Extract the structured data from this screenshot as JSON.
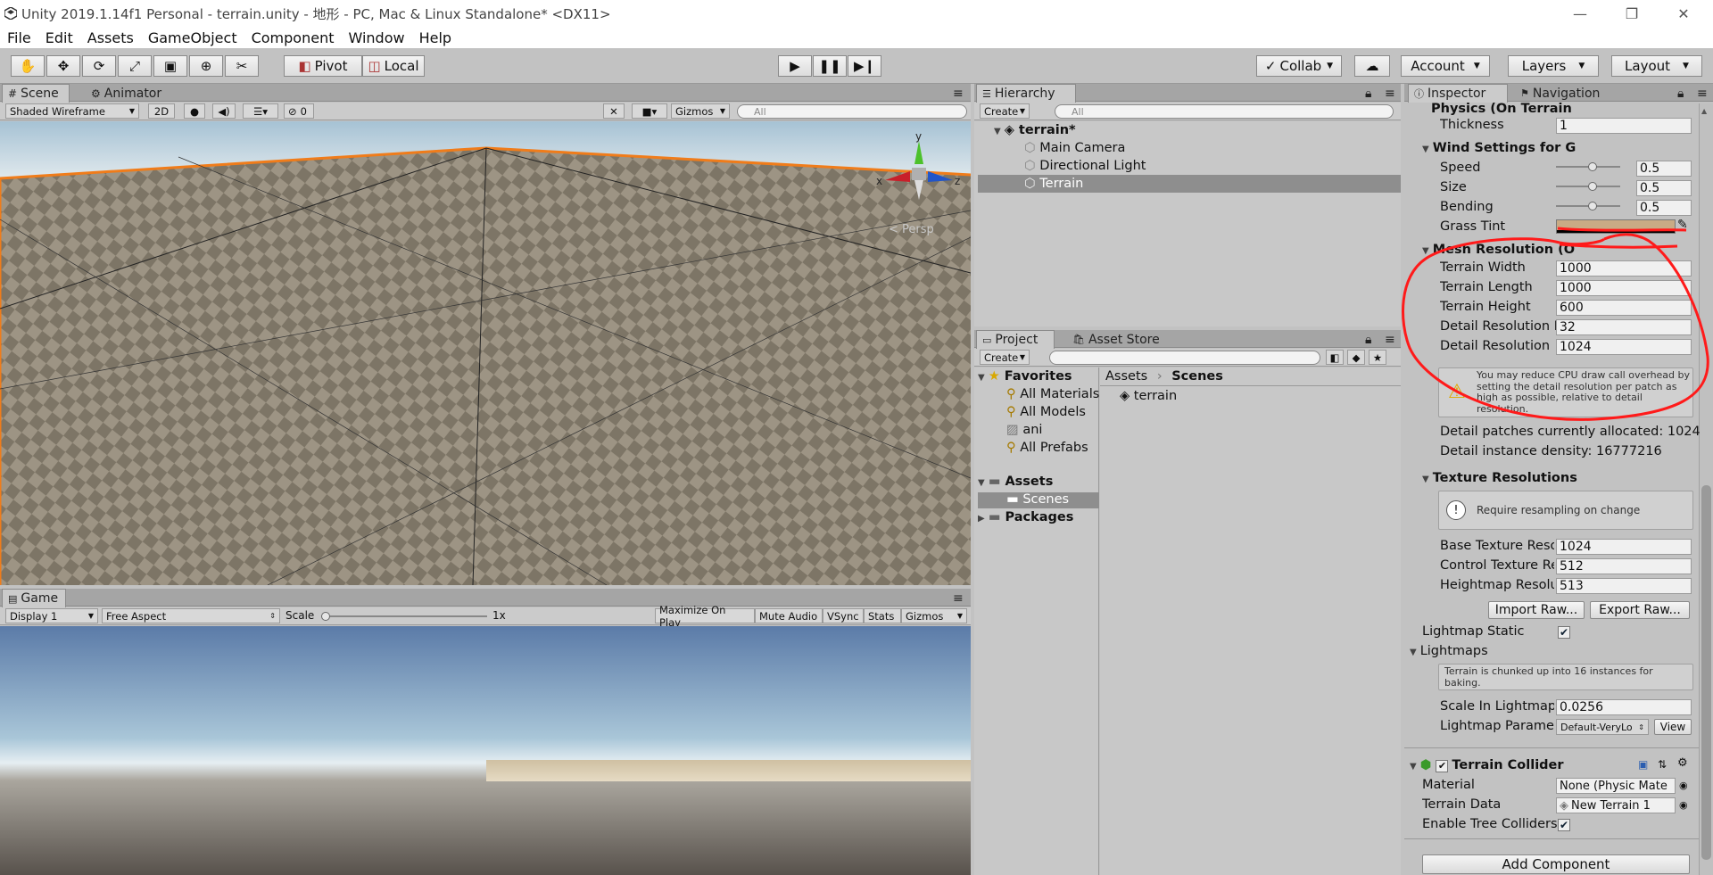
{
  "window": {
    "title": "Unity 2019.1.14f1 Personal - terrain.unity - 地形 - PC, Mac & Linux Standalone* <DX11>"
  },
  "menu": [
    "File",
    "Edit",
    "Assets",
    "GameObject",
    "Component",
    "Window",
    "Help"
  ],
  "toolbar": {
    "pivot": "Pivot",
    "local": "Local",
    "collab": "Collab",
    "account": "Account",
    "layers": "Layers",
    "layout": "Layout"
  },
  "scene": {
    "tab_scene": "Scene",
    "tab_animator": "Animator",
    "shading": "Shaded Wireframe",
    "mode_2d": "2D",
    "hidden_count": "0",
    "gizmos": "Gizmos",
    "search_placeholder": "All",
    "persp": "< Persp",
    "axis_x": "x",
    "axis_y": "y",
    "axis_z": "z"
  },
  "game": {
    "tab": "Game",
    "display": "Display 1",
    "aspect": "Free Aspect",
    "scale_label": "Scale",
    "scale_value": "1x",
    "maximize": "Maximize On Play",
    "mute": "Mute Audio",
    "vsync": "VSync",
    "stats": "Stats",
    "gizmos": "Gizmos"
  },
  "hierarchy": {
    "tab": "Hierarchy",
    "create": "Create",
    "search_placeholder": "All",
    "scene_name": "terrain*",
    "items": [
      "Main Camera",
      "Directional Light",
      "Terrain"
    ]
  },
  "project": {
    "tab_project": "Project",
    "tab_asset_store": "Asset Store",
    "create": "Create",
    "favorites": "Favorites",
    "fav_items": [
      "All Materials",
      "All Models",
      "ani",
      "All Prefabs"
    ],
    "assets": "Assets",
    "scenes": "Scenes",
    "packages": "Packages",
    "breadcrumb_root": "Assets",
    "breadcrumb_child": "Scenes",
    "files": [
      "terrain"
    ]
  },
  "inspector": {
    "tab_inspector": "Inspector",
    "tab_navigation": "Navigation",
    "physics_header": "Physics (On Terrain",
    "thickness_label": "Thickness",
    "thickness_value": "1",
    "wind_header": "Wind Settings for G",
    "speed_label": "Speed",
    "speed_value": "0.5",
    "size_label": "Size",
    "size_value": "0.5",
    "bending_label": "Bending",
    "bending_value": "0.5",
    "grass_tint_label": "Grass Tint",
    "mesh_header": "Mesh Resolution (O",
    "terrain_width_label": "Terrain Width",
    "terrain_width_value": "1000",
    "terrain_length_label": "Terrain Length",
    "terrain_length_value": "1000",
    "terrain_height_label": "Terrain Height",
    "terrain_height_value": "600",
    "detail_per_patch_label": "Detail Resolution P",
    "detail_per_patch_value": "32",
    "detail_res_label": "Detail Resolution",
    "detail_res_value": "1024",
    "warning_text": "You may reduce CPU draw call overhead by setting the detail resolution per patch as high as possible, relative to detail resolution.",
    "detail_patches": "Detail patches currently allocated: 1024",
    "detail_density": "Detail instance density: 16777216",
    "texture_header": "Texture Resolutions",
    "resample_text": "Require resampling on change",
    "base_tex_label": "Base Texture Reso",
    "base_tex_value": "1024",
    "control_tex_label": "Control Texture Re",
    "control_tex_value": "512",
    "heightmap_label": "Heightmap Resolut",
    "heightmap_value": "513",
    "import_raw": "Import Raw...",
    "export_raw": "Export Raw...",
    "lightmap_static_label": "Lightmap Static",
    "lightmaps_header": "Lightmaps",
    "chunk_text": "Terrain is chunked up into 16 instances for baking.",
    "scale_lightmap_label": "Scale In Lightmap",
    "scale_lightmap_value": "0.0256",
    "lightmap_params_label": "Lightmap Paramete",
    "lightmap_params_value": "Default-VeryLo",
    "view_button": "View",
    "collider_header": "Terrain Collider",
    "material_label": "Material",
    "material_value": "None (Physic Mate",
    "terrain_data_label": "Terrain Data",
    "terrain_data_value": "New Terrain 1",
    "tree_colliders_label": "Enable Tree Colliders",
    "add_component": "Add Component"
  },
  "colors": {
    "selection": "#f07c1a",
    "annotation": "#ff1a1a",
    "grass_tint": "#c9ab85"
  }
}
